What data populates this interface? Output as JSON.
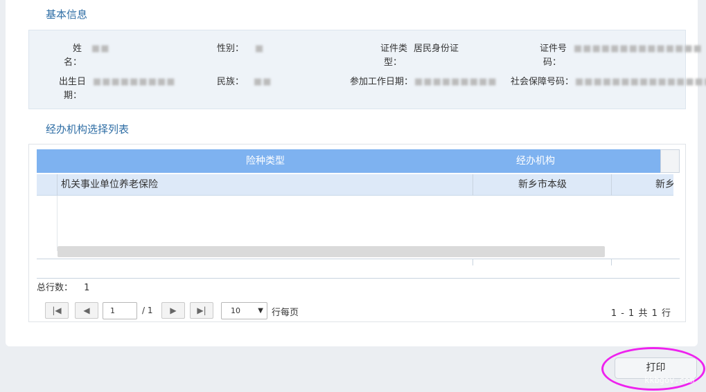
{
  "basic_info": {
    "title": "基本信息",
    "fields": {
      "name": {
        "label": "姓名：",
        "value": "■■"
      },
      "gender": {
        "label": "性别：",
        "value": "■"
      },
      "id_type": {
        "label_line1": "证件类",
        "label_line2": "型：",
        "value": "居民身份证"
      },
      "id_number": {
        "label_line1": "证件号",
        "label_line2": "码：",
        "value": "■■■■■■■■■■■■■■"
      },
      "birth_date": {
        "label_line1": "出生日",
        "label_line2": "期：",
        "value": "■■■■■■■■■"
      },
      "ethnicity": {
        "label": "民族：",
        "value": "■■"
      },
      "work_start": {
        "label": "参加工作日期：",
        "value": "■■■■■■■■■"
      },
      "social_security_no": {
        "label": "社会保障号码：",
        "value": "■■■■■■■■■■■■■■■"
      }
    }
  },
  "agency_list": {
    "title": "经办机构选择列表",
    "columns": [
      "险种类型",
      "经办机构"
    ],
    "rows": [
      {
        "insurance_type": "机关事业单位养老保险",
        "agency": "新乡市本级",
        "agency_extra": "新乡"
      }
    ],
    "total_label": "总行数：",
    "total_value": "1"
  },
  "pager": {
    "current_page": "1",
    "of_pages": "/ 1",
    "per_page": "10",
    "per_page_label": "行每页",
    "range_text": "1 - 1 共 1 行"
  },
  "actions": {
    "print_label": "打印"
  },
  "colors": {
    "header_blue": "#7eb2f0",
    "title_blue": "#2f6ea5",
    "highlight_magenta": "#ee22ee"
  },
  "watermark": "kkbgov.com"
}
